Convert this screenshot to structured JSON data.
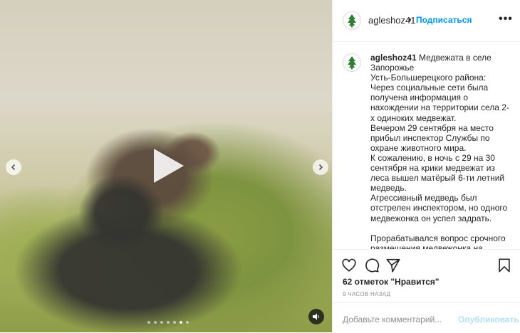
{
  "post": {
    "username": "agleshoz41",
    "separator": "•",
    "follow_label": "Подписаться",
    "more_label": "•••",
    "caption_username": "agleshoz41",
    "caption_text": "Медвежата в селе Запорожье\nУсть-Большерецкого района:\nЧерез социальные сети была получена информация о нахождении на территории села 2-х одиноких медвежат.\nВечером 29 сентября на место прибыл инспектор Службы по охране животного мира.\nК сожалению, в ночь с 29 на 30 сентября на крики медвежат из леса вышел матёрый 6-ти летний медведь.\nАгрессивный медведь был отстрелен инспектором, но одного медвежонка он успел задрать.\n\nПрорабатывался вопрос срочного размещения медвежонка на",
    "likes": "62 отметок \"Нравится\"",
    "time": "9 ЧАСОВ НАЗАД",
    "comment_placeholder": "Добавьте комментарий...",
    "publish_label": "Опубликовать"
  },
  "media": {
    "carousel_dots": 7,
    "active_dot": 5
  },
  "icons": {
    "avatar": "forest-tree-logo-icon",
    "like": "heart-icon",
    "comment": "comment-bubble-icon",
    "share": "paper-plane-icon",
    "save": "bookmark-icon",
    "play": "play-icon",
    "prev": "chevron-left-icon",
    "next": "chevron-right-icon",
    "mute": "speaker-icon"
  },
  "colors": {
    "accent": "#0095f6",
    "publish_disabled": "#b2dffc",
    "logo_green": "#2e7d32"
  }
}
